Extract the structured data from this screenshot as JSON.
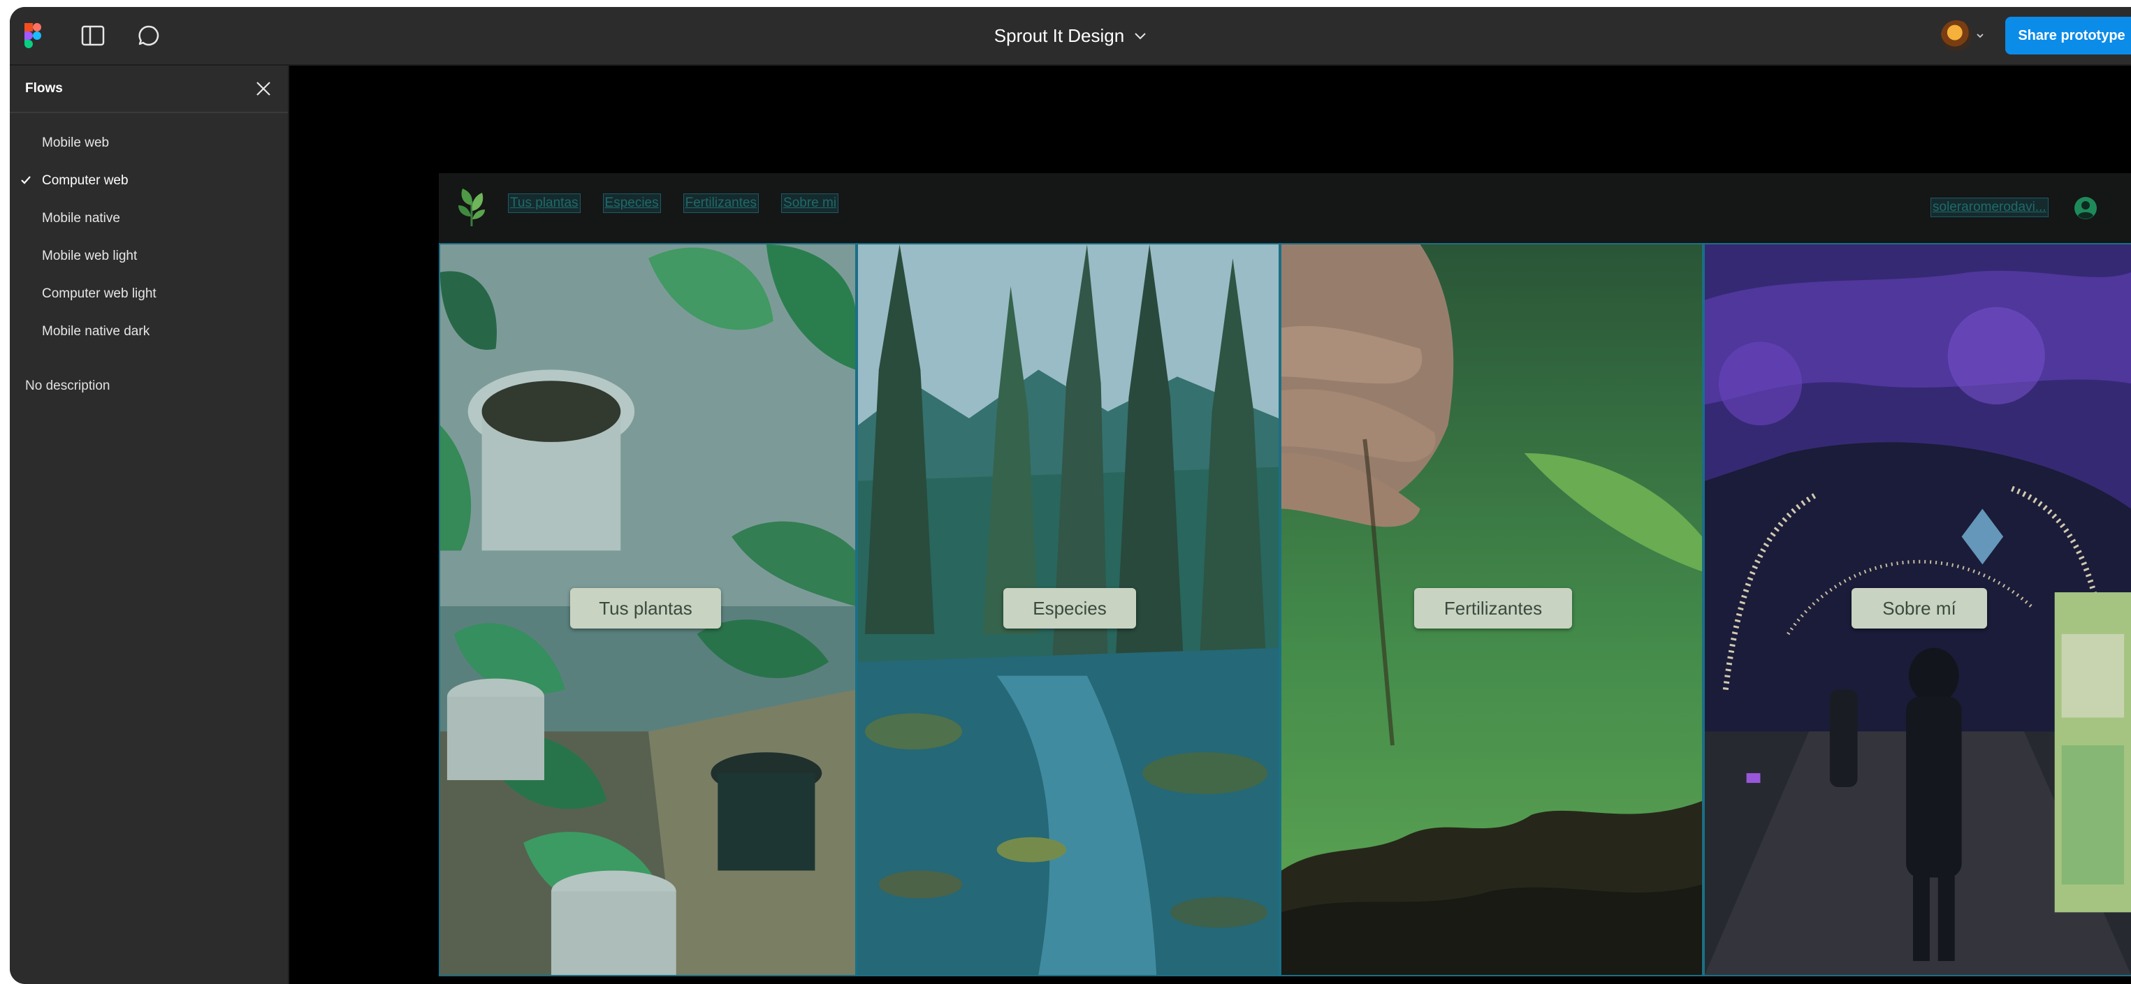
{
  "app": {
    "file_title": "Sprout It Design",
    "share_label": "Share prototype"
  },
  "flows": {
    "header": "Flows",
    "items": [
      {
        "label": "Mobile web",
        "selected": false
      },
      {
        "label": "Computer web",
        "selected": true
      },
      {
        "label": "Mobile native",
        "selected": false
      },
      {
        "label": "Mobile web light",
        "selected": false
      },
      {
        "label": "Computer web light",
        "selected": false
      },
      {
        "label": "Mobile native dark",
        "selected": false
      }
    ],
    "description": "No description"
  },
  "prototype": {
    "nav_links": [
      "Tus plantas",
      "Especies",
      "Fertilizantes",
      "Sobre mi"
    ],
    "user_email": "soleraromerodavi...",
    "panels": [
      {
        "label": "Tus plantas",
        "scene": "houseplants"
      },
      {
        "label": "Especies",
        "scene": "forest-river"
      },
      {
        "label": "Fertilizantes",
        "scene": "soil-hand"
      },
      {
        "label": "Sobre mí",
        "scene": "night-lights"
      }
    ]
  },
  "colors": {
    "accent": "#0c8ce9",
    "toolbar": "#2c2c2c",
    "canvas": "#000000",
    "panel_border": "#1b6f86",
    "label_bg": "#c9d3c1"
  },
  "icons": [
    "figma-logo-icon",
    "sidebar-toggle-icon",
    "comment-icon",
    "chevron-down-icon",
    "close-icon",
    "check-icon",
    "leaf-logo-icon",
    "user-circle-icon"
  ]
}
